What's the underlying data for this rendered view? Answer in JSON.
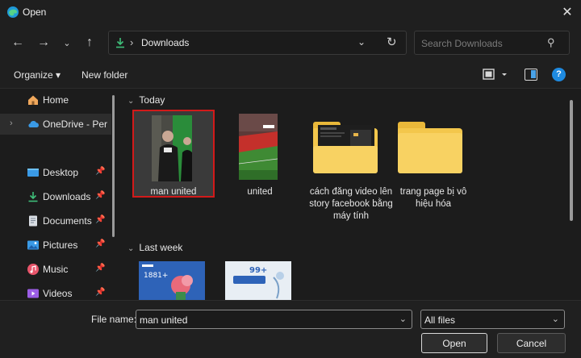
{
  "window": {
    "title": "Open",
    "app_icon": "edge-icon"
  },
  "nav": {
    "address_folder": "Downloads",
    "search_placeholder": "Search Downloads"
  },
  "toolbar": {
    "organize": "Organize ▾",
    "new_folder": "New folder"
  },
  "sidebar": {
    "items": [
      {
        "label": "Home",
        "icon": "home-icon"
      },
      {
        "label": "OneDrive - Perso",
        "icon": "cloud-icon"
      },
      {
        "label": "Desktop",
        "icon": "desktop-icon",
        "pinned": true
      },
      {
        "label": "Downloads",
        "icon": "download-icon",
        "pinned": true
      },
      {
        "label": "Documents",
        "icon": "document-icon",
        "pinned": true
      },
      {
        "label": "Pictures",
        "icon": "pictures-icon",
        "pinned": true
      },
      {
        "label": "Music",
        "icon": "music-icon",
        "pinned": true
      },
      {
        "label": "Videos",
        "icon": "videos-icon",
        "pinned": true
      }
    ]
  },
  "groups": [
    {
      "header": "Today",
      "items": [
        {
          "label": "man united",
          "type": "video",
          "selected": true
        },
        {
          "label": "united",
          "type": "video"
        },
        {
          "label": "cách đăng video lên story facebook bằng máy tính",
          "type": "folder-with-content"
        },
        {
          "label": "trang page bị vô hiệu hóa",
          "type": "folder"
        }
      ]
    },
    {
      "header": "Last week",
      "items": [
        {
          "label": "",
          "type": "image"
        },
        {
          "label": "",
          "type": "image"
        }
      ]
    }
  ],
  "footer": {
    "file_name_label": "File name:",
    "file_name_value": "man united",
    "file_type": "All files",
    "open_label": "Open",
    "cancel_label": "Cancel"
  },
  "colors": {
    "accent": "#1e8ae0",
    "selection_border": "#d21a1a",
    "folder": "#f3c74c"
  }
}
